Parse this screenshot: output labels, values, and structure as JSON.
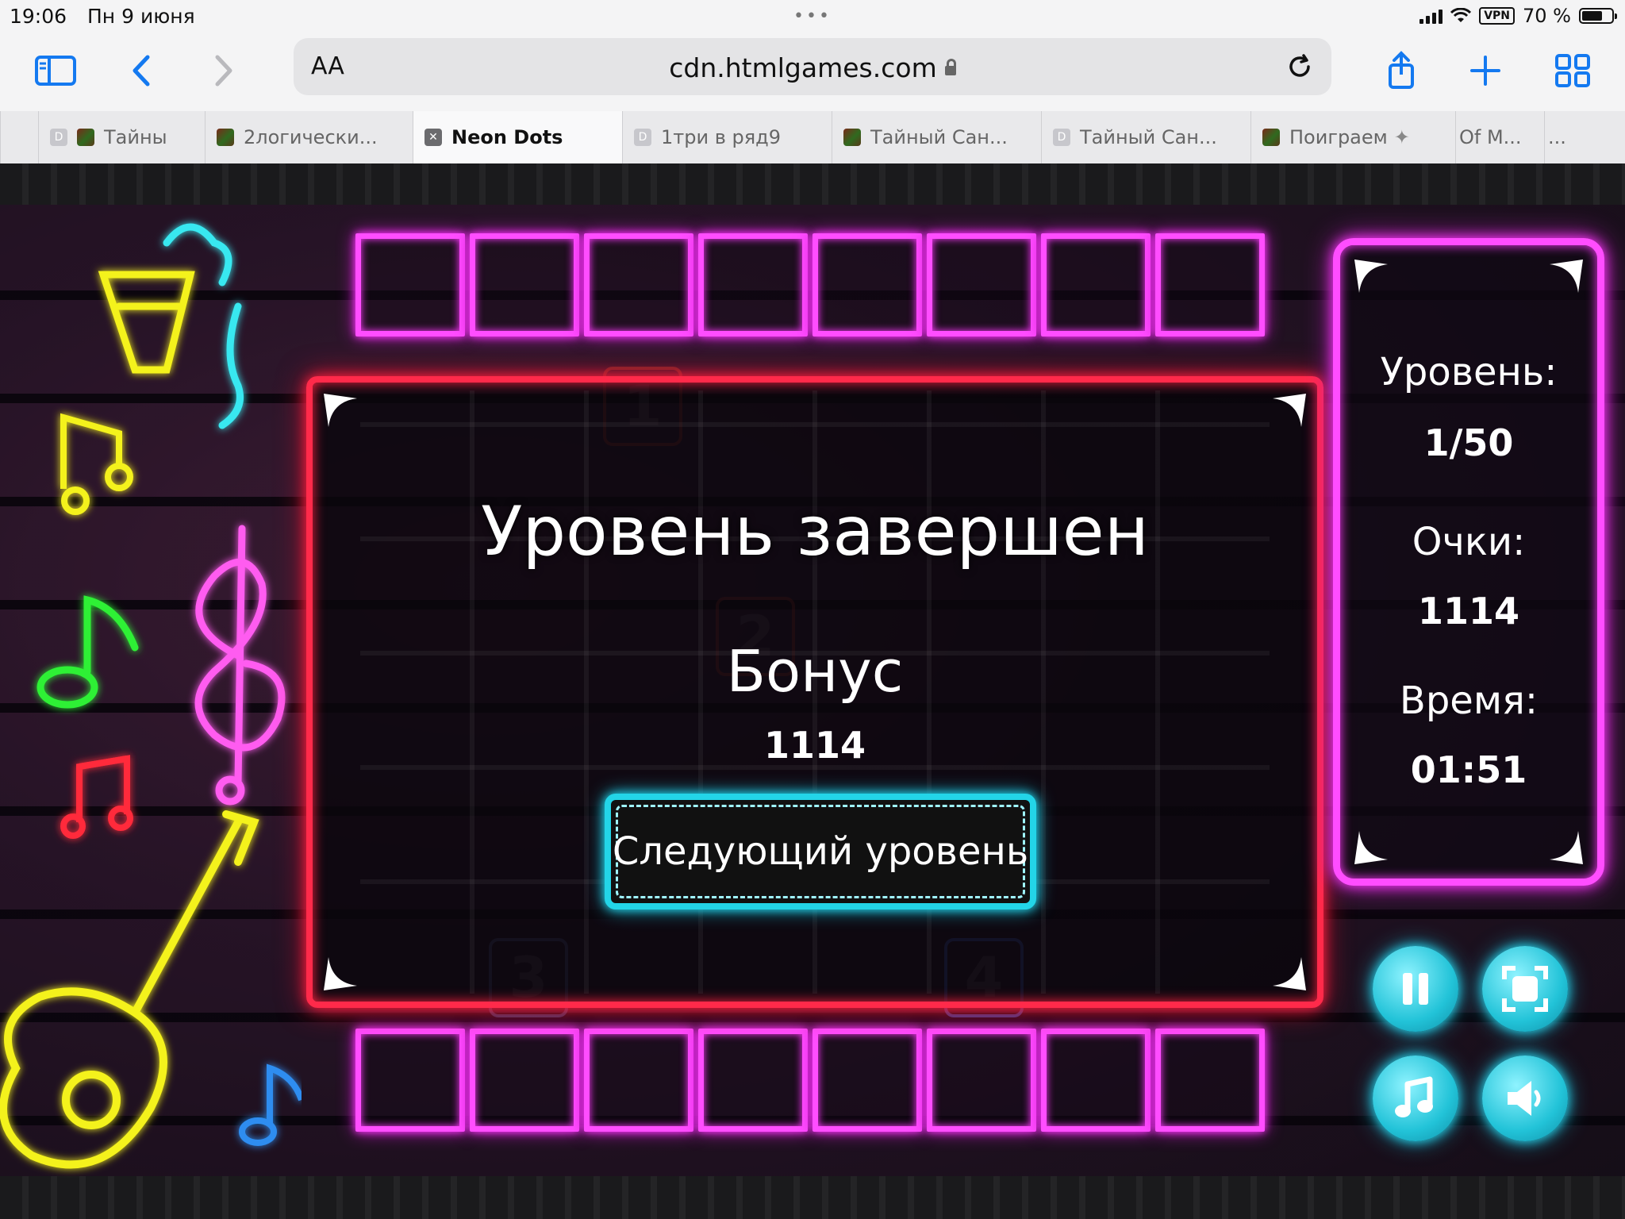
{
  "status_bar": {
    "time": "19:06",
    "date": "Пн 9 июня",
    "vpn": "VPN",
    "battery": "70 %",
    "battery_level": 0.7
  },
  "toolbar": {
    "text_size_label": "AA",
    "url": "cdn.htmlgames.com"
  },
  "tabs": [
    {
      "label": "Тайны",
      "favicon": "d-icon"
    },
    {
      "label": "2логически...",
      "favicon": "game-favicon"
    },
    {
      "label": "Neon Dots",
      "favicon": "close-icon",
      "active": true
    },
    {
      "label": "1три в ряд9",
      "favicon": "d-icon"
    },
    {
      "label": "Тайный Сан...",
      "favicon": "game-favicon"
    },
    {
      "label": "Тайный Сан...",
      "favicon": "d-icon"
    },
    {
      "label": "Поиграем",
      "favicon": "game-favicon"
    },
    {
      "label": "Of M...",
      "favicon": ""
    },
    {
      "label": "...",
      "favicon": ""
    }
  ],
  "dialog": {
    "title": "Уровень завершен",
    "bonus_label": "Бонус",
    "bonus_value": "1114",
    "next_button": "Следующий уровень"
  },
  "ghost_numbers": [
    "1",
    "2",
    "3",
    "4"
  ],
  "side_panel": {
    "level_label": "Уровень:",
    "level_value": "1/50",
    "score_label": "Очки:",
    "score_value": "1114",
    "time_label": "Время:",
    "time_value": "01:51"
  },
  "controls": [
    "pause-icon",
    "fullscreen-icon",
    "music-icon",
    "sound-icon"
  ],
  "colors": {
    "neon_pink": "#ff4dff",
    "neon_red": "#ff2a4a",
    "neon_cyan": "#23d5e8"
  }
}
